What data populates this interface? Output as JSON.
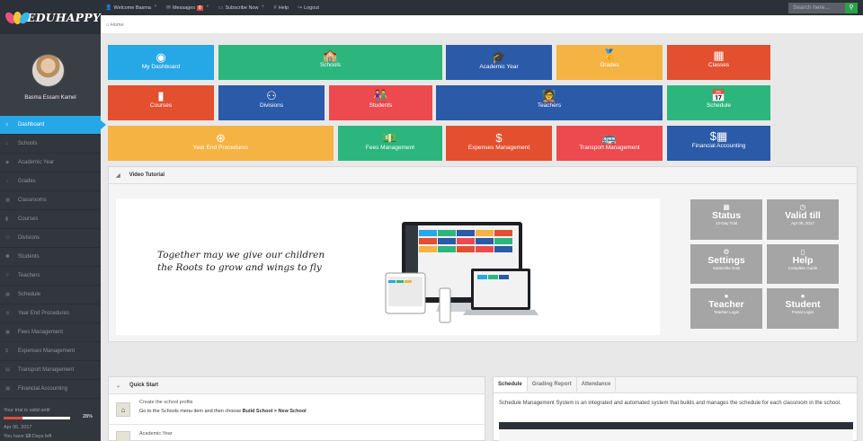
{
  "brand": {
    "name": "EDUHAPPY"
  },
  "topnav": {
    "welcome": "Welcome Basma",
    "messages": "Messages",
    "messages_count": "0",
    "subscribe": "Subscribe Now",
    "help": "Help",
    "logout": "Logout",
    "search_placeholder": "Search here..."
  },
  "breadcrumb": {
    "home": "Home"
  },
  "user": {
    "name": "Basma Essam Kamel"
  },
  "sidebar": {
    "items": [
      {
        "label": "Dashboard",
        "icon": "home-icon"
      },
      {
        "label": "Schools",
        "icon": "school-icon"
      },
      {
        "label": "Academic Year",
        "icon": "graduation-cap-icon"
      },
      {
        "label": "Grades",
        "icon": "medal-icon"
      },
      {
        "label": "Classrooms",
        "icon": "classroom-icon"
      },
      {
        "label": "Courses",
        "icon": "book-icon"
      },
      {
        "label": "Divisions",
        "icon": "people-circle-icon"
      },
      {
        "label": "Students",
        "icon": "students-icon"
      },
      {
        "label": "Teachers",
        "icon": "teacher-icon"
      },
      {
        "label": "Schedule",
        "icon": "calendar-icon"
      },
      {
        "label": "Year End Procedures",
        "icon": "procedures-icon"
      },
      {
        "label": "Fees Management",
        "icon": "money-icon"
      },
      {
        "label": "Expenses Management",
        "icon": "dollar-icon"
      },
      {
        "label": "Transport Management",
        "icon": "bus-icon"
      },
      {
        "label": "Financial Accounting",
        "icon": "calculator-icon"
      }
    ]
  },
  "trial": {
    "valid_text": "Your trial is valid until",
    "percent": "28%",
    "progress": 0.28,
    "date": "Apr 06, 2017",
    "days_text": "You have 10 Days left"
  },
  "tiles": {
    "my_dashboard": "My Dashboard",
    "schools": "Schools",
    "academic_year": "Academic Year",
    "grades": "Grades",
    "classes": "Classes",
    "courses": "Courses",
    "divisions": "Divisions",
    "students": "Students",
    "teachers": "Teachers",
    "schedule": "Schedule",
    "year_end": "Year End Procedures",
    "fees": "Fees Management",
    "expenses": "Expenses Management",
    "transport": "Transport Management",
    "financial": "Financial Accounting"
  },
  "colors": {
    "blue": "#26a7e6",
    "green": "#2cb67d",
    "orange": "#f5b343",
    "red": "#e2502f",
    "darkblue": "#2a5aa8",
    "pink": "#ec4a4f"
  },
  "video": {
    "title": "Video Tutorial",
    "quote_line1": "Together may we give our children",
    "quote_line2": "the Roots to grow and wings to fly"
  },
  "status_tiles": {
    "status": "Status",
    "status_sub": "14-Day Trial",
    "valid": "Valid till",
    "valid_sub": "Apr 06, 2017",
    "settings": "Settings",
    "settings_sub": "Subscribe Now",
    "help": "Help",
    "help_sub": "Complete Guide",
    "teacher": "Teacher",
    "teacher_sub": "Teacher Login",
    "student": "Student",
    "student_sub": "Portal Login"
  },
  "quick_start": {
    "title": "Quick Start",
    "step1_title": "Create the school profile",
    "step1_pre": "Go to the Schools menu item and then choose ",
    "step1_bold": "Build School > New School",
    "step2_title": "Academic Year"
  },
  "tabs": {
    "schedule": "Schedule",
    "grading": "Grading Report",
    "attendance": "Attendance"
  },
  "schedule_desc": "Schedule Management System is an integrated and automated system that builds and manages the schedule for each classroom in the school."
}
